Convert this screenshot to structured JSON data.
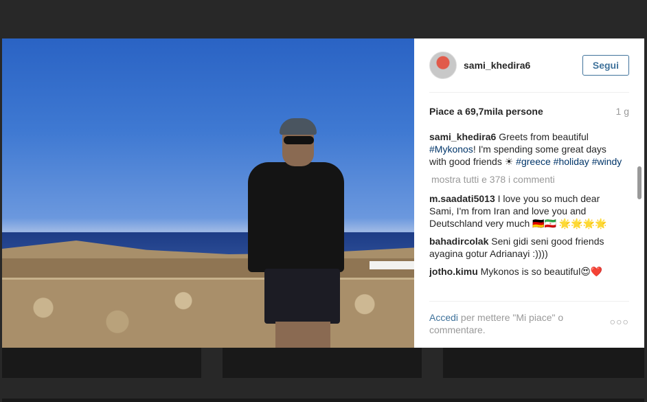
{
  "post": {
    "username": "sami_khedira6",
    "follow_label": "Segui",
    "likes": "Piace a 69,7mila persone",
    "time_ago": "1 g"
  },
  "caption": {
    "author": "sami_khedira6",
    "text_1": "Greets from beautiful",
    "tag_mykonos": "#Mykonos",
    "text_2": "! I'm spending some great days with good friends ☀ ",
    "tag_greece": "#greece",
    "tag_holiday": "#holiday",
    "tag_windy": "#windy"
  },
  "show_all_comments": "mostra tutti e 378 i commenti",
  "comments": [
    {
      "author": "m.saadati5013",
      "text": "I love you so much dear Sami, I'm from Iran and love you and Deutschland very much 🇩🇪🇮🇷 🌟🌟🌟🌟"
    },
    {
      "author": "bahadircolak",
      "text": "Seni gidi seni good friends ayagina gotur Adrianayi :))))"
    },
    {
      "author": "jotho.kimu",
      "text": "Mykonos is so beautiful😍❤️"
    }
  ],
  "footer": {
    "login_link": "Accedi",
    "login_text": "per mettere \"Mi piace\" o commentare.",
    "more_label": "○○○"
  },
  "colors": {
    "link_blue": "#3f729b",
    "hashtag_blue": "#003569",
    "muted": "#999999"
  }
}
